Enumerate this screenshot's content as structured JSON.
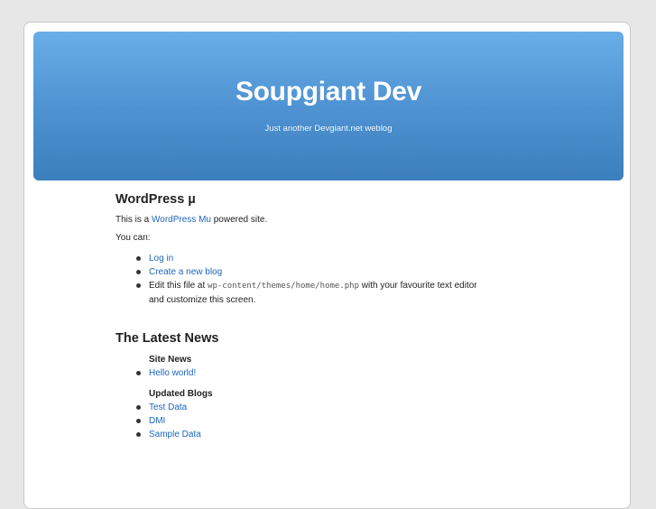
{
  "header": {
    "title": "Soupgiant Dev",
    "tagline": "Just another Devgiant.net weblog"
  },
  "intro": {
    "heading": "WordPress µ",
    "powered_prefix": "This is a ",
    "powered_link": "WordPress Mu",
    "powered_suffix": " powered site.",
    "you_can": "You can:",
    "actions": {
      "login": "Log in",
      "create_blog": "Create a new blog",
      "edit_prefix": "Edit this file at ",
      "edit_path": "wp-content/themes/home/home.php",
      "edit_suffix": " with your favourite text editor and customize this screen."
    }
  },
  "news": {
    "heading": "The Latest News",
    "site_news_label": "Site News",
    "site_news": [
      "Hello world!"
    ],
    "updated_blogs_label": "Updated Blogs",
    "updated_blogs": [
      "Test Data",
      "DMI",
      "Sample Data"
    ]
  },
  "colors": {
    "header_top": "#69aee7",
    "header_bottom": "#3c7fbd",
    "link": "#1a67c0",
    "page_bg": "#e7e7e7"
  }
}
